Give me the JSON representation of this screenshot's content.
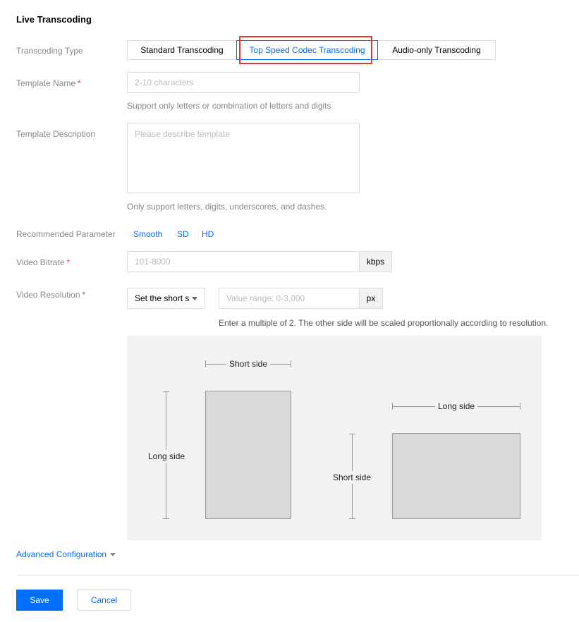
{
  "section_title": "Live Transcoding",
  "transcoding_type": {
    "label": "Transcoding Type",
    "options": [
      "Standard Transcoding",
      "Top Speed Codec Transcoding",
      "Audio-only Transcoding"
    ],
    "selected": "Top Speed Codec Transcoding"
  },
  "template_name": {
    "label": "Template Name",
    "required_mark": "*",
    "placeholder": "2-10 characters",
    "hint": "Support only letters or combination of letters and digits"
  },
  "template_description": {
    "label": "Template Description",
    "placeholder": "Please describe template",
    "hint": "Only support letters, digits, underscores, and dashes."
  },
  "recommended_parameter": {
    "label": "Recommended Parameter",
    "options": [
      "Smooth",
      "SD",
      "HD"
    ]
  },
  "video_bitrate": {
    "label": "Video Bitrate",
    "required_mark": "*",
    "placeholder": "101-8000",
    "unit": "kbps"
  },
  "video_resolution": {
    "label": "Video Resolution",
    "required_mark": "*",
    "select_value": "Set the short s",
    "placeholder": "Value range: 0-3,000",
    "unit": "px",
    "hint": "Enter a multiple of 2. The other side will be scaled proportionally according to resolution."
  },
  "diagram": {
    "portrait_short_label": "Short side",
    "portrait_long_label": "Long side",
    "landscape_long_label": "Long side",
    "landscape_short_label": "Short side"
  },
  "advanced_configuration": "Advanced Configuration",
  "buttons": {
    "save": "Save",
    "cancel": "Cancel"
  },
  "colors": {
    "primary": "#006eff",
    "highlight": "#e53935",
    "required": "#e54545"
  }
}
